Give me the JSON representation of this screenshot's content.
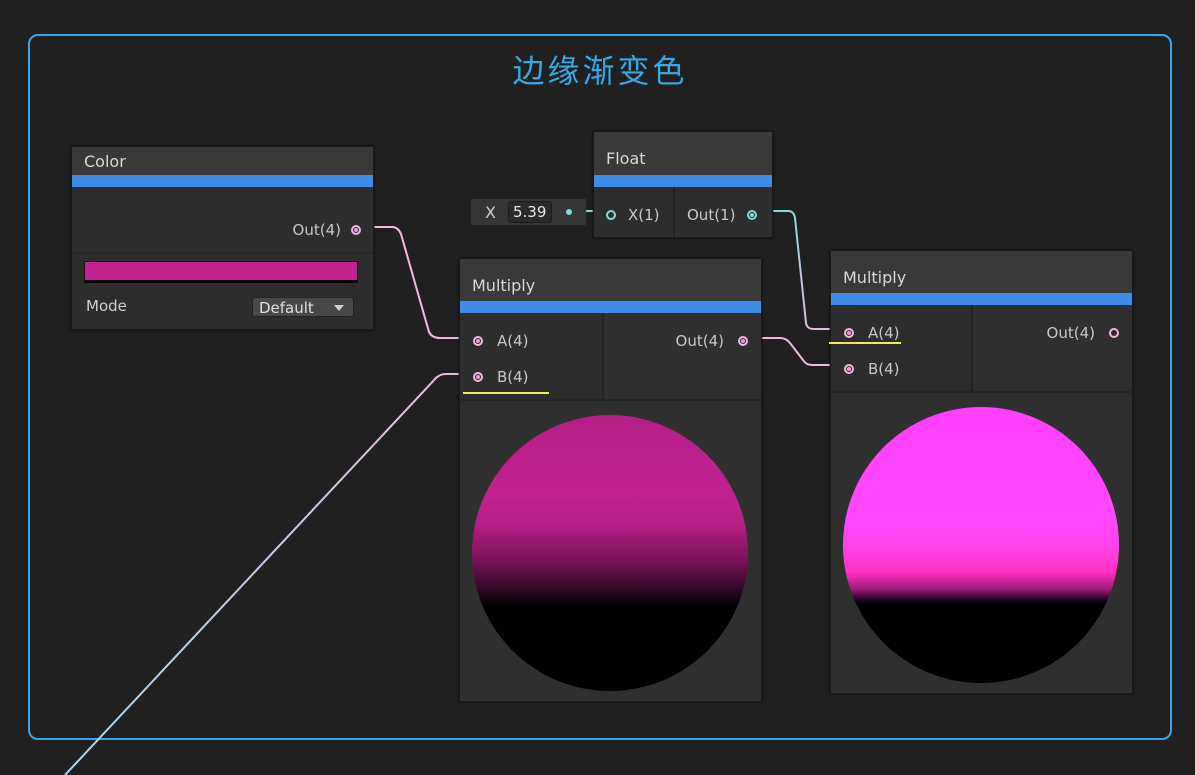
{
  "group": {
    "title": "边缘渐变色",
    "color": "#37a7e5"
  },
  "color_node": {
    "title": "Color",
    "out_label": "Out(4)",
    "swatch_color": "#c2218e",
    "mode_label": "Mode",
    "mode_value": "Default"
  },
  "float_node": {
    "title": "Float",
    "in_label": "X(1)",
    "out_label": "Out(1)",
    "field_label": "X",
    "field_value": "5.39"
  },
  "multiply_left": {
    "title": "Multiply",
    "in_a": "A(4)",
    "in_b": "B(4)",
    "out_label": "Out(4)",
    "preview_color": "#c2218e"
  },
  "multiply_right": {
    "title": "Multiply",
    "in_a": "A(4)",
    "in_b": "B(4)",
    "out_label": "Out(4)",
    "preview_color": "#ff45ff"
  },
  "colors": {
    "accent": "#3f8ce6",
    "wire_pink": "#f2b8e4",
    "wire_cyan": "#86d9d9",
    "highlight": "#f5ea4a"
  }
}
